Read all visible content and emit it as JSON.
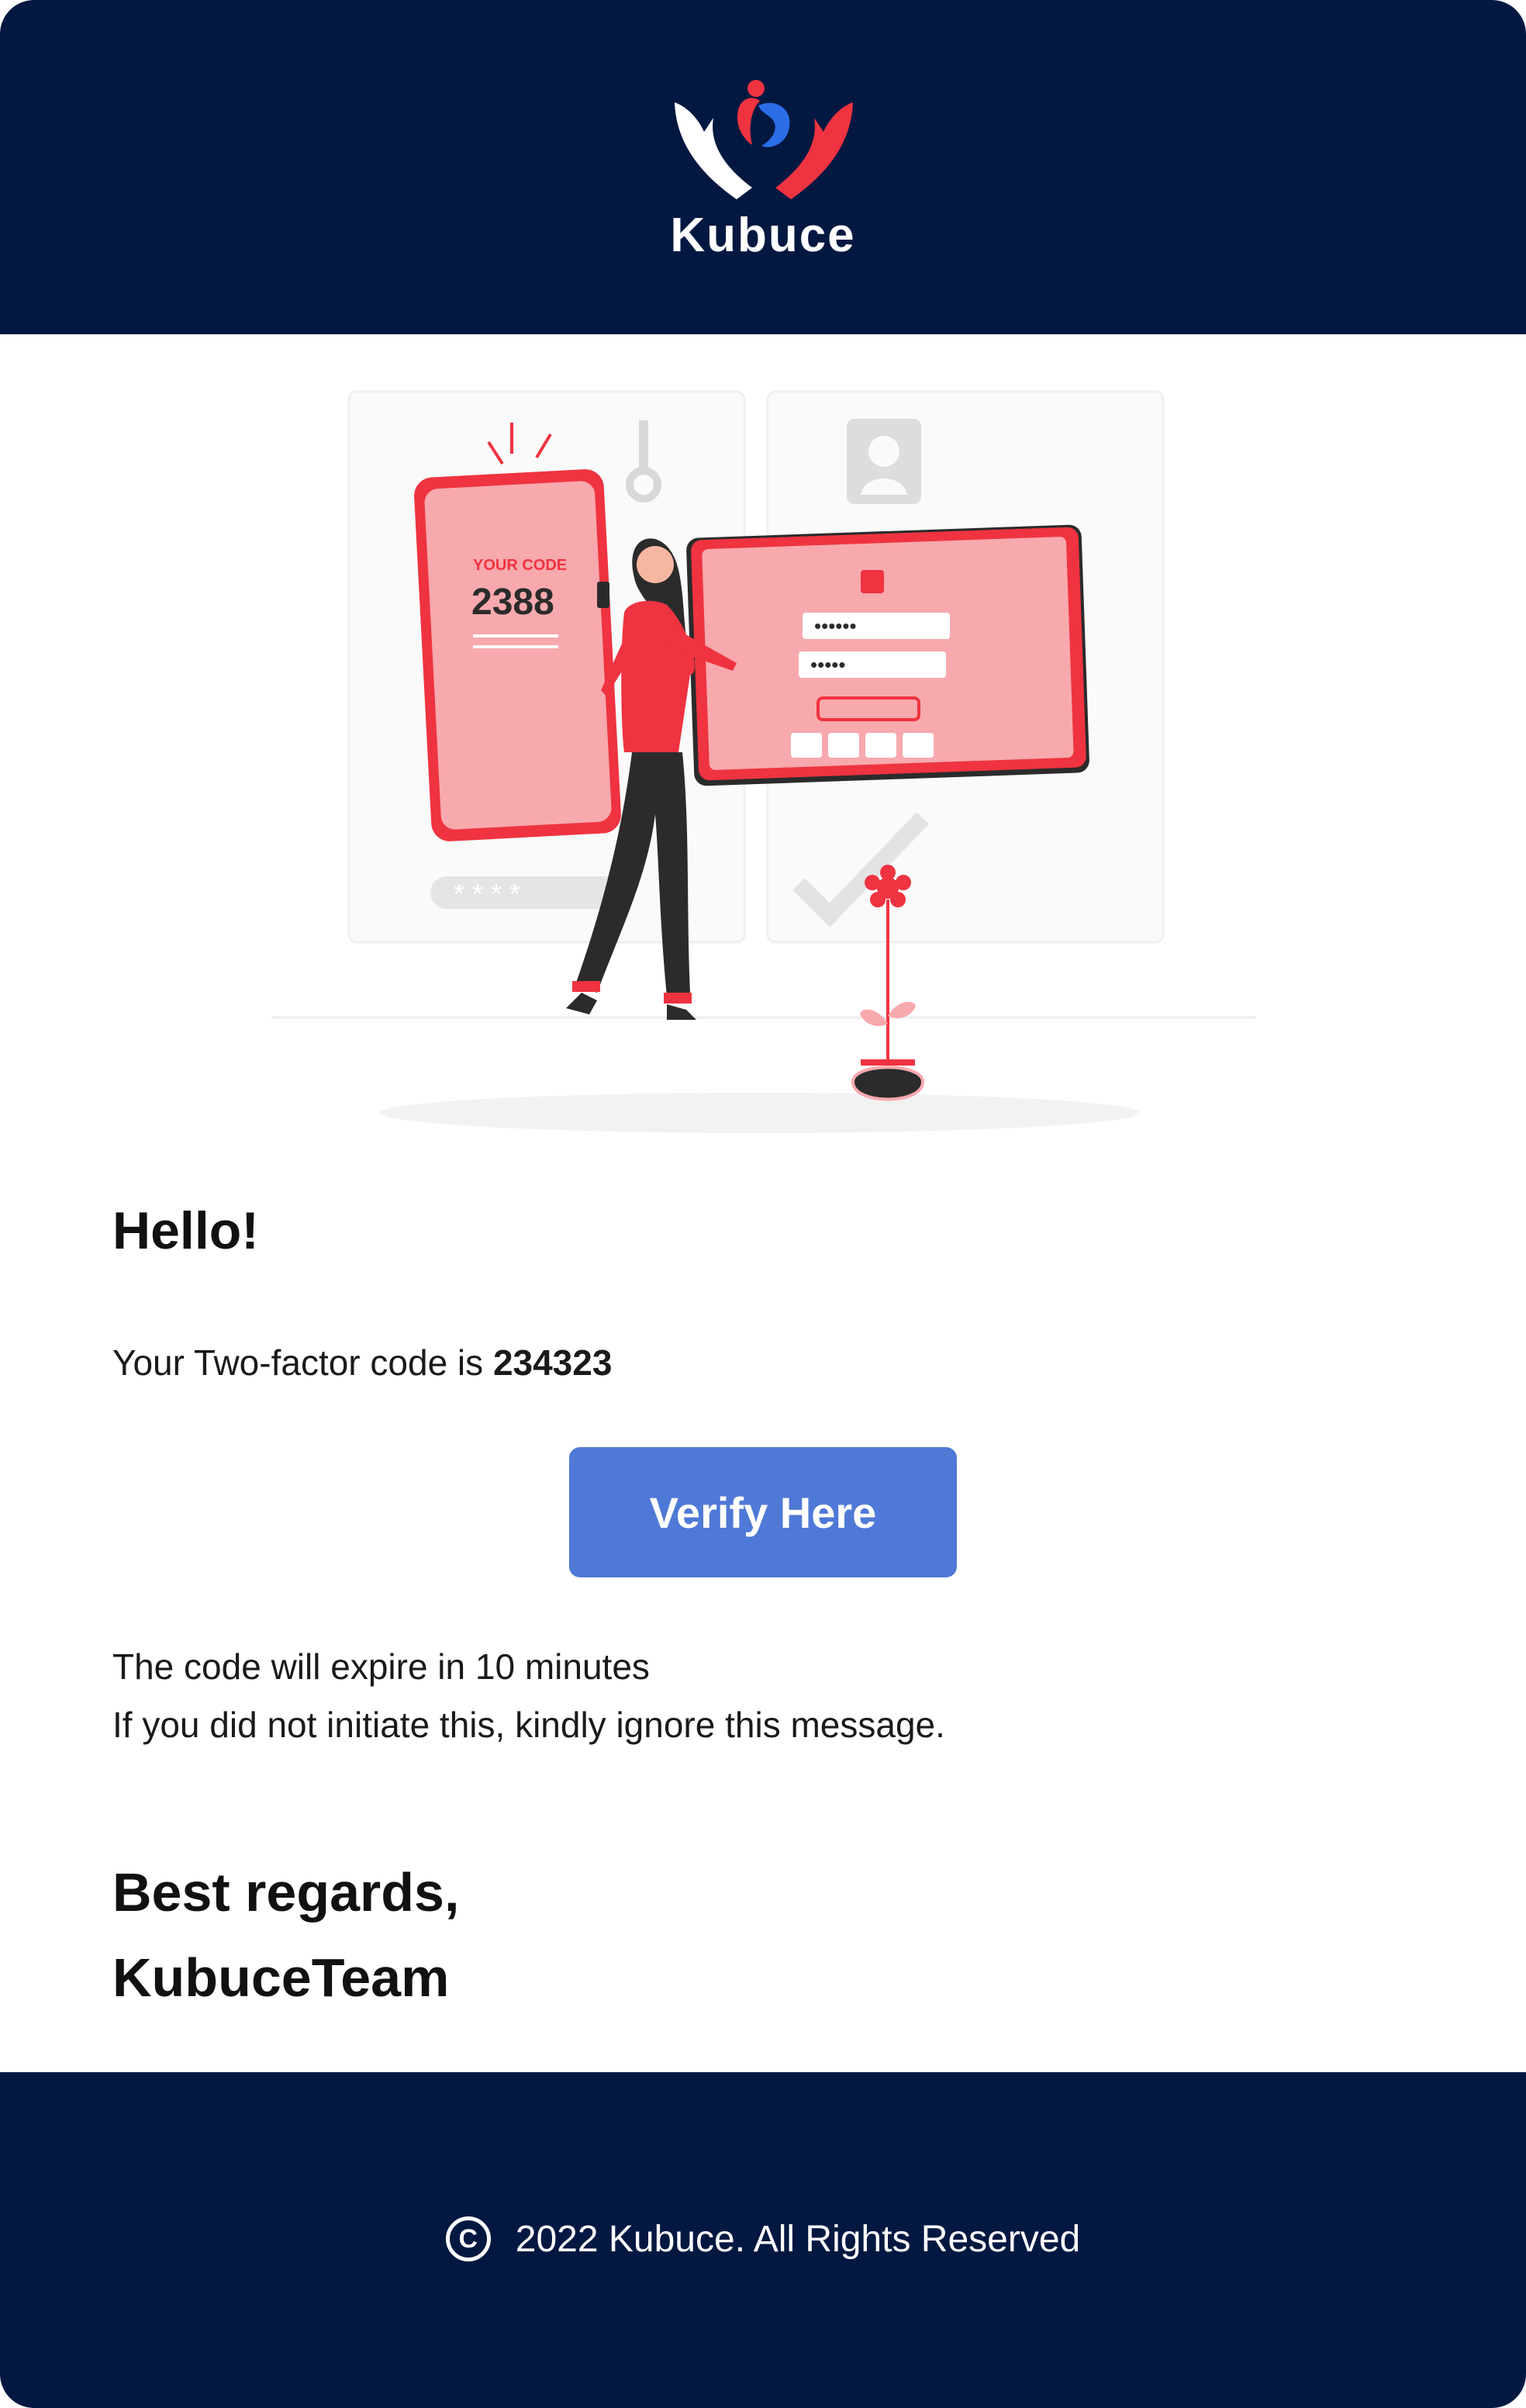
{
  "header": {
    "brand": "Kubuce",
    "logo_icon": "hands-people-logo-icon"
  },
  "illustration": {
    "icon": "two-factor-illustration",
    "phone_label": "YOUR CODE",
    "phone_code": "2388"
  },
  "body": {
    "greeting": "Hello!",
    "code_prefix": "Your Two-factor code is ",
    "code": "234323",
    "verify_label": "Verify Here",
    "expire_text": "The code will expire in 10 minutes",
    "ignore_text": "If  you did not initiate this, kindly ignore this message.",
    "regards": "Best regards,",
    "team": "KubuceTeam"
  },
  "footer": {
    "copyright_symbol": "C",
    "copyright_text": "2022 Kubuce. All Rights Reserved"
  },
  "colors": {
    "navy": "#021841",
    "button": "#4f79d6",
    "accent_red": "#ef3340",
    "accent_blue": "#2c6ee8"
  }
}
